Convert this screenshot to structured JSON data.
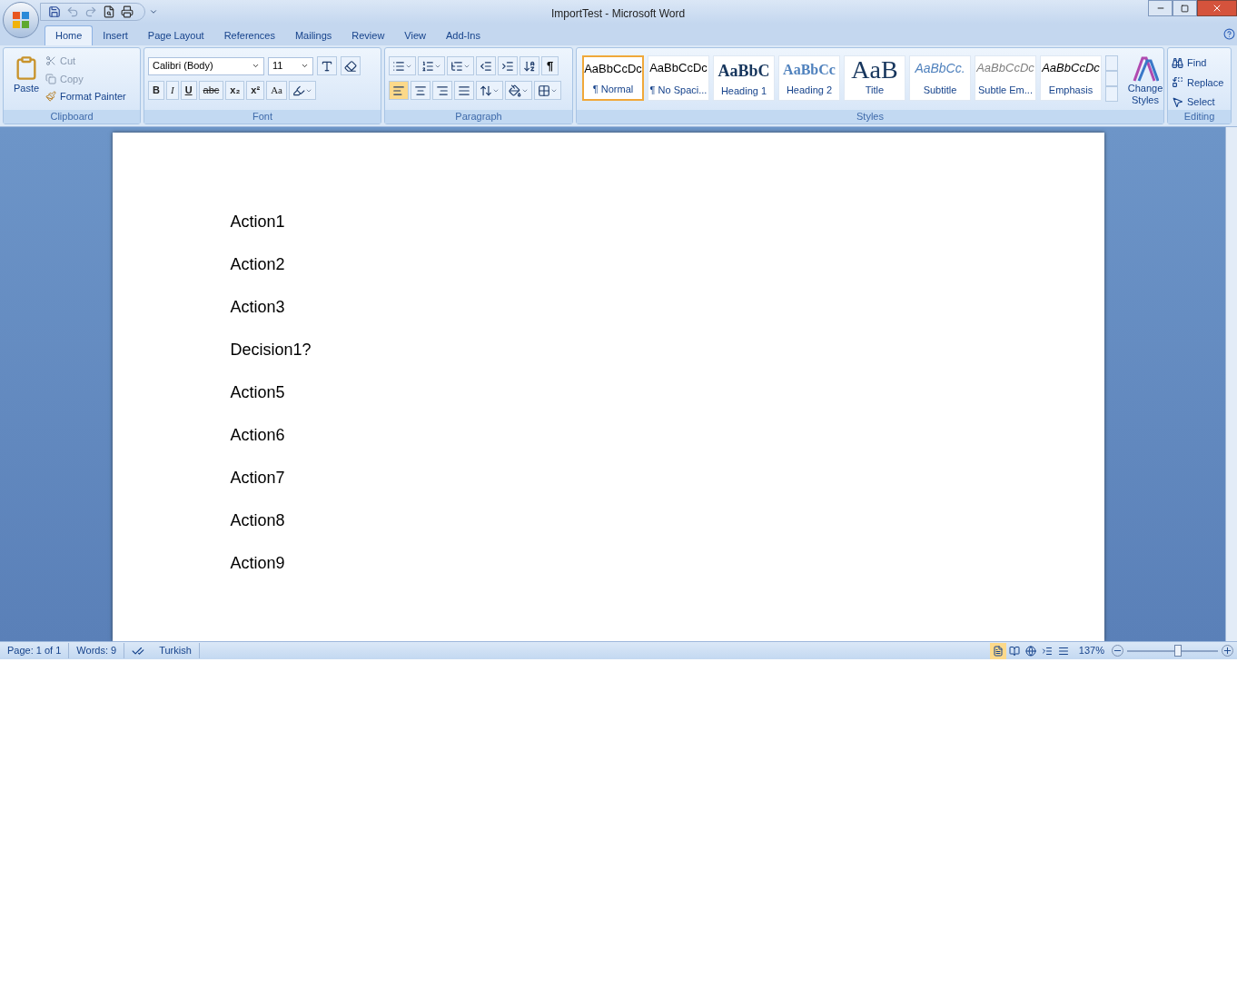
{
  "window": {
    "title": "ImportTest - Microsoft Word"
  },
  "tabs": [
    {
      "label": "Home",
      "selected": true
    },
    {
      "label": "Insert",
      "selected": false
    },
    {
      "label": "Page Layout",
      "selected": false
    },
    {
      "label": "References",
      "selected": false
    },
    {
      "label": "Mailings",
      "selected": false
    },
    {
      "label": "Review",
      "selected": false
    },
    {
      "label": "View",
      "selected": false
    },
    {
      "label": "Add-Ins",
      "selected": false
    }
  ],
  "clipboard": {
    "paste": "Paste",
    "cut": "Cut",
    "copy": "Copy",
    "format_painter": "Format Painter",
    "group": "Clipboard"
  },
  "font": {
    "name": "Calibri (Body)",
    "size": "11",
    "group": "Font",
    "buttons": [
      {
        "label": "B",
        "kind": "bold"
      },
      {
        "label": "I",
        "kind": "italic"
      },
      {
        "label": "U",
        "kind": "underline"
      },
      {
        "label": "abc",
        "kind": "strike"
      },
      {
        "label": "x₂",
        "kind": "sub"
      },
      {
        "label": "x²",
        "kind": "sup"
      },
      {
        "label": "Aa",
        "kind": "case"
      }
    ]
  },
  "paragraph": {
    "group": "Paragraph",
    "pilcrow": "¶",
    "align": [
      {
        "selected": true
      },
      {
        "selected": false
      },
      {
        "selected": false
      },
      {
        "selected": false
      }
    ]
  },
  "styles": {
    "group": "Styles",
    "items": [
      {
        "sample": "AaBbCcDc",
        "name": "¶ Normal",
        "kind": "normal",
        "selected": true
      },
      {
        "sample": "AaBbCcDc",
        "name": "¶ No Spaci...",
        "kind": "normal",
        "selected": false
      },
      {
        "sample": "AaBbC",
        "name": "Heading 1",
        "kind": "h1",
        "selected": false
      },
      {
        "sample": "AaBbCc",
        "name": "Heading 2",
        "kind": "h2",
        "selected": false
      },
      {
        "sample": "AaB",
        "name": "Title",
        "kind": "title",
        "selected": false
      },
      {
        "sample": "AaBbCc.",
        "name": "Subtitle",
        "kind": "subtitle",
        "selected": false
      },
      {
        "sample": "AaBbCcDc",
        "name": "Subtle Em...",
        "kind": "subtle",
        "selected": false
      },
      {
        "sample": "AaBbCcDc",
        "name": "Emphasis",
        "kind": "emphasis",
        "selected": false
      }
    ],
    "change": "Change Styles"
  },
  "editing": {
    "group": "Editing",
    "find": "Find",
    "replace": "Replace",
    "select": "Select"
  },
  "document": {
    "paragraphs": [
      "Action1",
      "Action2",
      "Action3",
      "Decision1?",
      "Action5",
      "Action6",
      "Action7",
      "Action8",
      "Action9"
    ]
  },
  "status_bar": {
    "page": "Page: 1 of 1",
    "words": "Words: 9",
    "language": "Turkish",
    "zoom": "137%",
    "zoom_slider": {
      "level": 0.56
    },
    "views": [
      {
        "selected": true
      },
      {
        "selected": false
      },
      {
        "selected": false
      },
      {
        "selected": false
      },
      {
        "selected": false
      }
    ]
  }
}
